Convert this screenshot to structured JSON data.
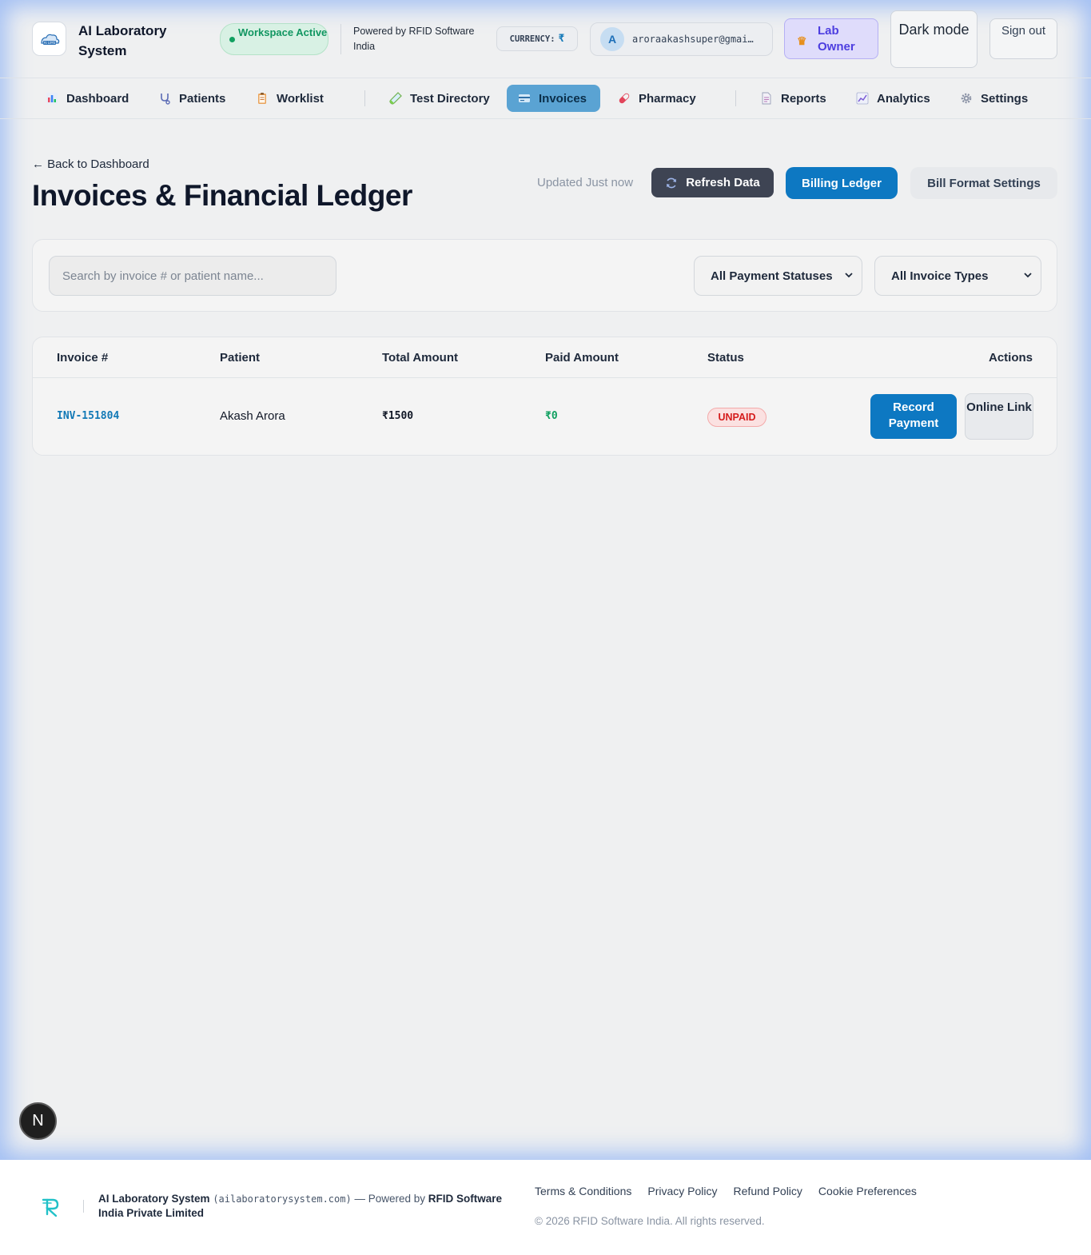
{
  "header": {
    "title": "AI Laboratory System",
    "workspace_status": "Workspace Active",
    "powered_by": "Powered by RFID Software India",
    "currency_label": "CURRENCY:",
    "currency_symbol": "₹",
    "user_initial": "A",
    "user_email": "aroraakashsuper@gmai…",
    "role": "Lab Owner",
    "dark_mode": "Dark mode",
    "sign_out": "Sign out"
  },
  "nav": {
    "items": [
      {
        "label": "Dashboard",
        "icon": "bar-chart-icon"
      },
      {
        "label": "Patients",
        "icon": "stethoscope-icon"
      },
      {
        "label": "Worklist",
        "icon": "clipboard-icon"
      },
      {
        "label": "Test Directory",
        "icon": "test-tube-icon"
      },
      {
        "label": "Invoices",
        "icon": "credit-card-icon"
      },
      {
        "label": "Pharmacy",
        "icon": "pill-icon"
      },
      {
        "label": "Reports",
        "icon": "document-icon"
      },
      {
        "label": "Analytics",
        "icon": "line-chart-icon"
      },
      {
        "label": "Settings",
        "icon": "gear-icon"
      }
    ],
    "active": "Invoices"
  },
  "page": {
    "back_link": "← Back to Dashboard",
    "title": "Invoices & Financial Ledger",
    "updated": "Updated Just now",
    "refresh_button": "Refresh Data",
    "ledger_button": "Billing Ledger",
    "format_button": "Bill Format Settings"
  },
  "filters": {
    "search_placeholder": "Search by invoice # or patient name...",
    "payment_status": "All Payment Statuses",
    "invoice_type": "All Invoice Types"
  },
  "table": {
    "headers": [
      "Invoice #",
      "Patient",
      "Total Amount",
      "Paid Amount",
      "Status",
      "Actions"
    ],
    "rows": [
      {
        "invoice": "INV-151804",
        "patient": "Akash Arora",
        "total": "₹1500",
        "paid": "₹0",
        "status": "UNPAID",
        "record_payment": "Record Payment",
        "online_link": "Online Link"
      }
    ]
  },
  "floating_badge": "N",
  "footer": {
    "brand": "AI Laboratory System",
    "domain": "(ailaboratorysystem.com)",
    "powered_prefix": " — Powered by ",
    "company": "RFID Software India Private Limited",
    "links": [
      "Terms & Conditions",
      "Privacy Policy",
      "Refund Policy",
      "Cookie Preferences"
    ],
    "copyright": "© 2026 RFID Software India. All rights reserved."
  },
  "colors": {
    "primary": "#0d78c2",
    "active_tab": "#5aa3d3",
    "success": "#10a060",
    "danger": "#d51c1c",
    "role_accent": "#4d3ee0"
  }
}
